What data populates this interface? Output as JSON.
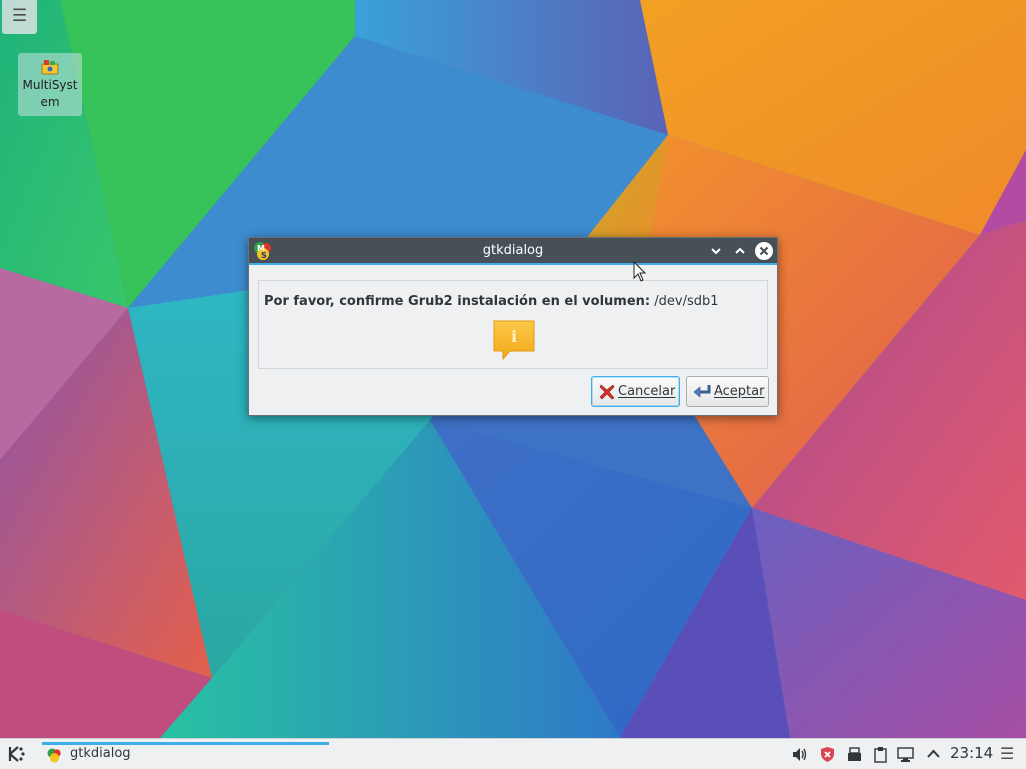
{
  "desktop": {
    "toolbox_icon": "hamburger-menu-icon",
    "icons": [
      {
        "label": "MultiSystem",
        "icon": "multisystem-app-icon"
      }
    ]
  },
  "window": {
    "title": "gtkdialog",
    "app_icon": "multisystem-app-icon",
    "titlebar_buttons": [
      "minimize",
      "maximize",
      "close"
    ],
    "message_bold": "Por favor, confirme Grub2 instalación en el volumen:",
    "message_value": "/dev/sdb1",
    "message_icon": "info-icon",
    "buttons": {
      "cancel": {
        "label": "Cancelar",
        "icon": "cancel-x-icon"
      },
      "accept": {
        "label": "Aceptar",
        "icon": "enter-arrow-icon"
      }
    }
  },
  "taskbar": {
    "launcher_icon": "kde-logo-icon",
    "tasks": [
      {
        "label": "gtkdialog",
        "icon": "multisystem-app-icon",
        "active": true
      }
    ],
    "tray_icons": [
      "volume-icon",
      "shield-update-icon",
      "usb-drive-icon",
      "clipboard-icon",
      "network-icon",
      "expand-tray-icon"
    ],
    "clock": "23:14",
    "menu_icon": "panel-menu-icon"
  },
  "colors": {
    "titlebar": "#475057",
    "accent": "#3daee9",
    "window_bg": "#eff0f1",
    "text": "#31363b"
  }
}
